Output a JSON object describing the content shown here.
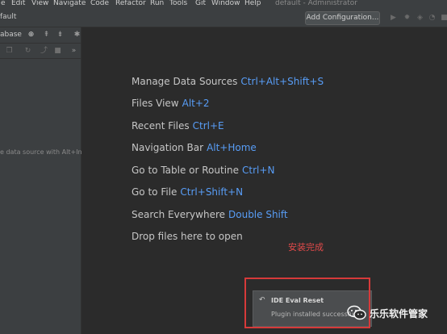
{
  "menubar": {
    "items": [
      "e",
      "Edit",
      "View",
      "Navigate",
      "Code",
      "Refactor",
      "Run",
      "Tools",
      "Git",
      "Window",
      "Help"
    ],
    "window_title": "default - Administrator"
  },
  "toolbar": {
    "breadcrumb": "fault",
    "add_configuration_label": "Add Configuration...",
    "icons": [
      "run-icon",
      "debug-icon",
      "coverage-icon",
      "profile-icon",
      "stop-icon"
    ]
  },
  "left_panel": {
    "title": "abase",
    "tool_icons": [
      "add-icon",
      "collapse-all-icon",
      "expand-all-icon",
      "settings-icon"
    ],
    "row_icons": [
      "copy-icon",
      "refresh-icon",
      "jump-icon",
      "stop-icon",
      "more-icon"
    ],
    "hint": "e data source with Alt+In"
  },
  "tips": [
    {
      "label": "Manage Data Sources",
      "key": "Ctrl+Alt+Shift+S"
    },
    {
      "label": "Files View",
      "key": "Alt+2"
    },
    {
      "label": "Recent Files",
      "key": "Ctrl+E"
    },
    {
      "label": "Navigation Bar",
      "key": "Alt+Home"
    },
    {
      "label": "Go to Table or Routine",
      "key": "Ctrl+N"
    },
    {
      "label": "Go to File",
      "key": "Ctrl+Shift+N"
    },
    {
      "label": "Search Everywhere",
      "key": "Double Shift"
    },
    {
      "label": "Drop files here to open",
      "key": ""
    }
  ],
  "annotation": "安装完成",
  "notification": {
    "icon": "undo-icon",
    "title": "IDE Eval Reset",
    "body": "Plugin installed successfully"
  },
  "watermark": {
    "text": "乐乐软件管家",
    "logo": "wechat-logo"
  },
  "colors": {
    "accent_key": "#589df6",
    "annotation_red": "#e04a4a",
    "frame_red": "#d63a3a"
  }
}
